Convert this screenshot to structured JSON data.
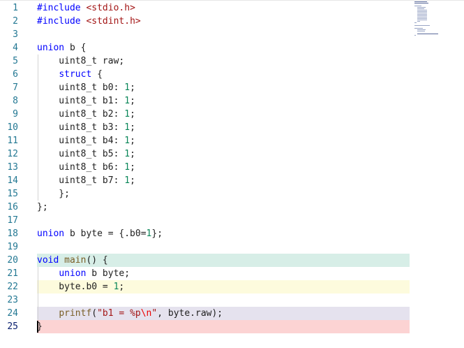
{
  "editor": {
    "lines": [
      {
        "n": "1",
        "tokens": [
          {
            "t": "#include ",
            "c": "pp"
          },
          {
            "t": "<stdio.h>",
            "c": "inc"
          }
        ]
      },
      {
        "n": "2",
        "tokens": [
          {
            "t": "#include ",
            "c": "pp"
          },
          {
            "t": "<stdint.h>",
            "c": "inc"
          }
        ]
      },
      {
        "n": "3",
        "tokens": []
      },
      {
        "n": "4",
        "tokens": [
          {
            "t": "union",
            "c": "kw"
          },
          {
            "t": " b {",
            "c": ""
          }
        ]
      },
      {
        "n": "5",
        "tokens": [
          {
            "t": "    uint8_t raw;",
            "c": ""
          }
        ]
      },
      {
        "n": "6",
        "tokens": [
          {
            "t": "    ",
            "c": ""
          },
          {
            "t": "struct",
            "c": "kw"
          },
          {
            "t": " {",
            "c": ""
          }
        ]
      },
      {
        "n": "7",
        "tokens": [
          {
            "t": "    uint8_t b0: ",
            "c": ""
          },
          {
            "t": "1",
            "c": "num"
          },
          {
            "t": ";",
            "c": ""
          }
        ]
      },
      {
        "n": "8",
        "tokens": [
          {
            "t": "    uint8_t b1: ",
            "c": ""
          },
          {
            "t": "1",
            "c": "num"
          },
          {
            "t": ";",
            "c": ""
          }
        ]
      },
      {
        "n": "9",
        "tokens": [
          {
            "t": "    uint8_t b2: ",
            "c": ""
          },
          {
            "t": "1",
            "c": "num"
          },
          {
            "t": ";",
            "c": ""
          }
        ]
      },
      {
        "n": "10",
        "tokens": [
          {
            "t": "    uint8_t b3: ",
            "c": ""
          },
          {
            "t": "1",
            "c": "num"
          },
          {
            "t": ";",
            "c": ""
          }
        ]
      },
      {
        "n": "11",
        "tokens": [
          {
            "t": "    uint8_t b4: ",
            "c": ""
          },
          {
            "t": "1",
            "c": "num"
          },
          {
            "t": ";",
            "c": ""
          }
        ]
      },
      {
        "n": "12",
        "tokens": [
          {
            "t": "    uint8_t b5: ",
            "c": ""
          },
          {
            "t": "1",
            "c": "num"
          },
          {
            "t": ";",
            "c": ""
          }
        ]
      },
      {
        "n": "13",
        "tokens": [
          {
            "t": "    uint8_t b6: ",
            "c": ""
          },
          {
            "t": "1",
            "c": "num"
          },
          {
            "t": ";",
            "c": ""
          }
        ]
      },
      {
        "n": "14",
        "tokens": [
          {
            "t": "    uint8_t b7: ",
            "c": ""
          },
          {
            "t": "1",
            "c": "num"
          },
          {
            "t": ";",
            "c": ""
          }
        ]
      },
      {
        "n": "15",
        "tokens": [
          {
            "t": "    };",
            "c": ""
          }
        ]
      },
      {
        "n": "16",
        "tokens": [
          {
            "t": "};",
            "c": ""
          }
        ]
      },
      {
        "n": "17",
        "tokens": []
      },
      {
        "n": "18",
        "tokens": [
          {
            "t": "union",
            "c": "kw"
          },
          {
            "t": " b byte = {.b0=",
            "c": ""
          },
          {
            "t": "1",
            "c": "num"
          },
          {
            "t": "};",
            "c": ""
          }
        ]
      },
      {
        "n": "19",
        "tokens": []
      },
      {
        "n": "20",
        "tokens": [
          {
            "t": "void",
            "c": "kw"
          },
          {
            "t": " ",
            "c": ""
          },
          {
            "t": "main",
            "c": "fn"
          },
          {
            "t": "() {",
            "c": ""
          }
        ]
      },
      {
        "n": "21",
        "tokens": [
          {
            "t": "    ",
            "c": ""
          },
          {
            "t": "union",
            "c": "kw"
          },
          {
            "t": " b byte;",
            "c": ""
          }
        ]
      },
      {
        "n": "22",
        "tokens": [
          {
            "t": "    byte.b0 = ",
            "c": ""
          },
          {
            "t": "1",
            "c": "num"
          },
          {
            "t": ";",
            "c": ""
          }
        ]
      },
      {
        "n": "23",
        "tokens": []
      },
      {
        "n": "24",
        "tokens": [
          {
            "t": "    ",
            "c": ""
          },
          {
            "t": "printf",
            "c": "fn"
          },
          {
            "t": "(",
            "c": ""
          },
          {
            "t": "\"b1 = %p",
            "c": "str"
          },
          {
            "t": "\\n",
            "c": "esc"
          },
          {
            "t": "\"",
            "c": "str"
          },
          {
            "t": ", byte.raw);",
            "c": ""
          }
        ]
      },
      {
        "n": "25",
        "tokens": [
          {
            "t": "}",
            "c": ""
          }
        ]
      }
    ],
    "highlights": [
      {
        "line": 20,
        "kind": "hl-green"
      },
      {
        "line": 22,
        "kind": "hl-yellow"
      },
      {
        "line": 24,
        "kind": "hl-violet"
      },
      {
        "line": 25,
        "kind": "hl-red"
      }
    ],
    "active_line": 25,
    "colors": {
      "keyword": "#0000ff",
      "number": "#098658",
      "string": "#a31515",
      "function": "#795e26",
      "line_number": "#237893"
    }
  }
}
